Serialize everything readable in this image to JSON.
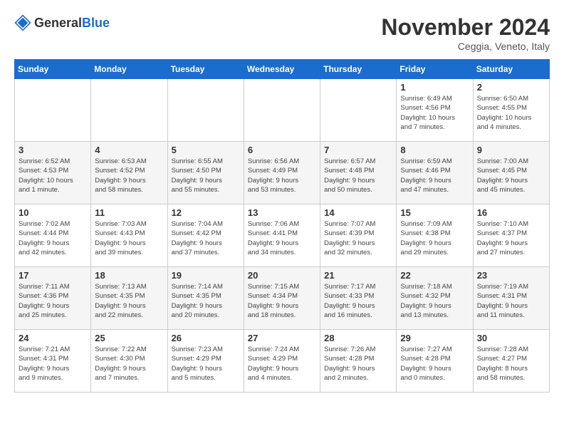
{
  "logo": {
    "general": "General",
    "blue": "Blue"
  },
  "title": "November 2024",
  "location": "Ceggia, Veneto, Italy",
  "days_of_week": [
    "Sunday",
    "Monday",
    "Tuesday",
    "Wednesday",
    "Thursday",
    "Friday",
    "Saturday"
  ],
  "weeks": [
    [
      {
        "day": "",
        "info": ""
      },
      {
        "day": "",
        "info": ""
      },
      {
        "day": "",
        "info": ""
      },
      {
        "day": "",
        "info": ""
      },
      {
        "day": "",
        "info": ""
      },
      {
        "day": "1",
        "info": "Sunrise: 6:49 AM\nSunset: 4:56 PM\nDaylight: 10 hours\nand 7 minutes."
      },
      {
        "day": "2",
        "info": "Sunrise: 6:50 AM\nSunset: 4:55 PM\nDaylight: 10 hours\nand 4 minutes."
      }
    ],
    [
      {
        "day": "3",
        "info": "Sunrise: 6:52 AM\nSunset: 4:53 PM\nDaylight: 10 hours\nand 1 minute."
      },
      {
        "day": "4",
        "info": "Sunrise: 6:53 AM\nSunset: 4:52 PM\nDaylight: 9 hours\nand 58 minutes."
      },
      {
        "day": "5",
        "info": "Sunrise: 6:55 AM\nSunset: 4:50 PM\nDaylight: 9 hours\nand 55 minutes."
      },
      {
        "day": "6",
        "info": "Sunrise: 6:56 AM\nSunset: 4:49 PM\nDaylight: 9 hours\nand 53 minutes."
      },
      {
        "day": "7",
        "info": "Sunrise: 6:57 AM\nSunset: 4:48 PM\nDaylight: 9 hours\nand 50 minutes."
      },
      {
        "day": "8",
        "info": "Sunrise: 6:59 AM\nSunset: 4:46 PM\nDaylight: 9 hours\nand 47 minutes."
      },
      {
        "day": "9",
        "info": "Sunrise: 7:00 AM\nSunset: 4:45 PM\nDaylight: 9 hours\nand 45 minutes."
      }
    ],
    [
      {
        "day": "10",
        "info": "Sunrise: 7:02 AM\nSunset: 4:44 PM\nDaylight: 9 hours\nand 42 minutes."
      },
      {
        "day": "11",
        "info": "Sunrise: 7:03 AM\nSunset: 4:43 PM\nDaylight: 9 hours\nand 39 minutes."
      },
      {
        "day": "12",
        "info": "Sunrise: 7:04 AM\nSunset: 4:42 PM\nDaylight: 9 hours\nand 37 minutes."
      },
      {
        "day": "13",
        "info": "Sunrise: 7:06 AM\nSunset: 4:41 PM\nDaylight: 9 hours\nand 34 minutes."
      },
      {
        "day": "14",
        "info": "Sunrise: 7:07 AM\nSunset: 4:39 PM\nDaylight: 9 hours\nand 32 minutes."
      },
      {
        "day": "15",
        "info": "Sunrise: 7:09 AM\nSunset: 4:38 PM\nDaylight: 9 hours\nand 29 minutes."
      },
      {
        "day": "16",
        "info": "Sunrise: 7:10 AM\nSunset: 4:37 PM\nDaylight: 9 hours\nand 27 minutes."
      }
    ],
    [
      {
        "day": "17",
        "info": "Sunrise: 7:11 AM\nSunset: 4:36 PM\nDaylight: 9 hours\nand 25 minutes."
      },
      {
        "day": "18",
        "info": "Sunrise: 7:13 AM\nSunset: 4:35 PM\nDaylight: 9 hours\nand 22 minutes."
      },
      {
        "day": "19",
        "info": "Sunrise: 7:14 AM\nSunset: 4:35 PM\nDaylight: 9 hours\nand 20 minutes."
      },
      {
        "day": "20",
        "info": "Sunrise: 7:15 AM\nSunset: 4:34 PM\nDaylight: 9 hours\nand 18 minutes."
      },
      {
        "day": "21",
        "info": "Sunrise: 7:17 AM\nSunset: 4:33 PM\nDaylight: 9 hours\nand 16 minutes."
      },
      {
        "day": "22",
        "info": "Sunrise: 7:18 AM\nSunset: 4:32 PM\nDaylight: 9 hours\nand 13 minutes."
      },
      {
        "day": "23",
        "info": "Sunrise: 7:19 AM\nSunset: 4:31 PM\nDaylight: 9 hours\nand 11 minutes."
      }
    ],
    [
      {
        "day": "24",
        "info": "Sunrise: 7:21 AM\nSunset: 4:31 PM\nDaylight: 9 hours\nand 9 minutes."
      },
      {
        "day": "25",
        "info": "Sunrise: 7:22 AM\nSunset: 4:30 PM\nDaylight: 9 hours\nand 7 minutes."
      },
      {
        "day": "26",
        "info": "Sunrise: 7:23 AM\nSunset: 4:29 PM\nDaylight: 9 hours\nand 5 minutes."
      },
      {
        "day": "27",
        "info": "Sunrise: 7:24 AM\nSunset: 4:29 PM\nDaylight: 9 hours\nand 4 minutes."
      },
      {
        "day": "28",
        "info": "Sunrise: 7:26 AM\nSunset: 4:28 PM\nDaylight: 9 hours\nand 2 minutes."
      },
      {
        "day": "29",
        "info": "Sunrise: 7:27 AM\nSunset: 4:28 PM\nDaylight: 9 hours\nand 0 minutes."
      },
      {
        "day": "30",
        "info": "Sunrise: 7:28 AM\nSunset: 4:27 PM\nDaylight: 8 hours\nand 58 minutes."
      }
    ]
  ]
}
